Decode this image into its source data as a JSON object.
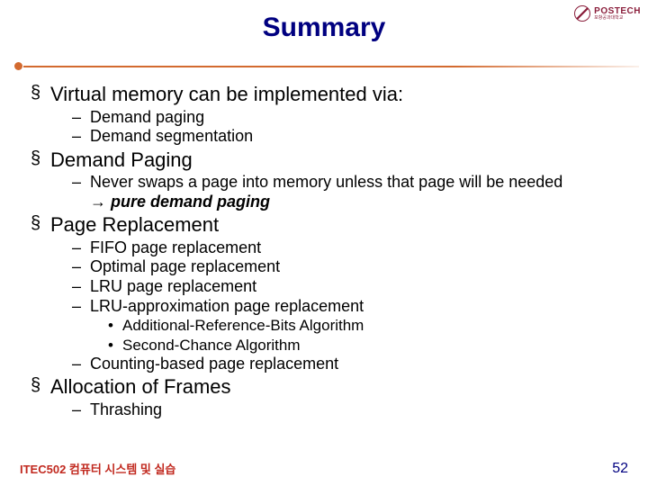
{
  "logo": {
    "main": "POSTECH",
    "sub": "포항공과대학교"
  },
  "title": "Summary",
  "bullets": {
    "b1": "Virtual memory can be implemented via:",
    "b1a": "Demand paging",
    "b1b": "Demand segmentation",
    "b2": "Demand Paging",
    "b2a": "Never swaps a page into memory unless that page will be needed",
    "b2a_arrow": "→ ",
    "b2a_emph": "pure demand paging",
    "b3": "Page Replacement",
    "b3a": "FIFO page replacement",
    "b3b": "Optimal page replacement",
    "b3c": "LRU page replacement",
    "b3d": "LRU-approximation page replacement",
    "b3d1": "Additional-Reference-Bits Algorithm",
    "b3d2": "Second-Chance Algorithm",
    "b3e": "Counting-based page replacement",
    "b4": "Allocation of Frames",
    "b4a": "Thrashing"
  },
  "footer": {
    "course": "ITEC502 컴퓨터 시스템 및 실습",
    "page": "52"
  }
}
